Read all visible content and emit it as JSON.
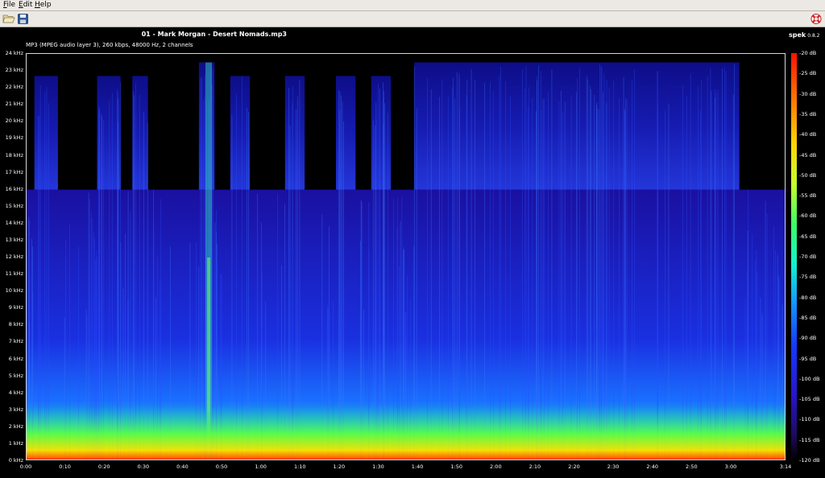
{
  "menu": [
    {
      "label": "File"
    },
    {
      "label": "Edit"
    },
    {
      "label": "Help"
    }
  ],
  "toolbar": {
    "open_icon": "folder-open-icon",
    "save_icon": "save-icon",
    "help_icon": "lifebuoy-icon"
  },
  "header": {
    "file_title": "01 - Mark Morgan - Desert Nomads.mp3",
    "file_info": "MP3 (MPEG audio layer 3), 260 kbps, 48000 Hz, 2 channels",
    "app_name": "spek",
    "app_version": "0.8.2"
  },
  "colors": {
    "background": "#000000",
    "low_energy": "#1a10a0",
    "high_energy": "#ff2000"
  },
  "chart_data": {
    "type": "heatmap",
    "y_ticks": [
      "0 kHz",
      "1 kHz",
      "2 kHz",
      "3 kHz",
      "4 kHz",
      "5 kHz",
      "6 kHz",
      "7 kHz",
      "8 kHz",
      "9 kHz",
      "10 kHz",
      "11 kHz",
      "12 kHz",
      "13 kHz",
      "14 kHz",
      "15 kHz",
      "16 kHz",
      "17 kHz",
      "18 kHz",
      "19 kHz",
      "20 kHz",
      "21 kHz",
      "22 kHz",
      "23 kHz",
      "24 kHz"
    ],
    "x_ticks": [
      "0:00",
      "0:10",
      "0:20",
      "0:30",
      "0:40",
      "0:50",
      "1:00",
      "1:10",
      "1:20",
      "1:30",
      "1:40",
      "1:50",
      "2:00",
      "2:10",
      "2:20",
      "2:30",
      "2:40",
      "2:50",
      "3:00",
      "3:14"
    ],
    "x_tick_seconds": [
      0,
      10,
      20,
      30,
      40,
      50,
      60,
      70,
      80,
      90,
      100,
      110,
      120,
      130,
      140,
      150,
      160,
      170,
      180,
      194
    ],
    "duration_seconds": 194,
    "ylim_khz": [
      0,
      24
    ],
    "db_ticks": [
      "-20 dB",
      "-25 dB",
      "-30 dB",
      "-35 dB",
      "-40 dB",
      "-45 dB",
      "-50 dB",
      "-55 dB",
      "-60 dB",
      "-65 dB",
      "-70 dB",
      "-75 dB",
      "-80 dB",
      "-85 dB",
      "-90 dB",
      "-95 dB",
      "-100 dB",
      "-105 dB",
      "-110 dB",
      "-115 dB",
      "-120 dB"
    ],
    "db_range": [
      -120,
      -20
    ],
    "cutoff_khz": 16,
    "bursts": [
      {
        "start": 2,
        "end": 8,
        "top_khz": 22.7
      },
      {
        "start": 18,
        "end": 24,
        "top_khz": 22.7
      },
      {
        "start": 27,
        "end": 31,
        "top_khz": 22.7
      },
      {
        "start": 44,
        "end": 48,
        "top_khz": 23.5
      },
      {
        "start": 52,
        "end": 57,
        "top_khz": 22.7
      },
      {
        "start": 66,
        "end": 71,
        "top_khz": 22.7
      },
      {
        "start": 79,
        "end": 84,
        "top_khz": 22.7
      },
      {
        "start": 88,
        "end": 93,
        "top_khz": 22.7
      },
      {
        "start": 99,
        "end": 182,
        "top_khz": 23.5
      }
    ]
  }
}
